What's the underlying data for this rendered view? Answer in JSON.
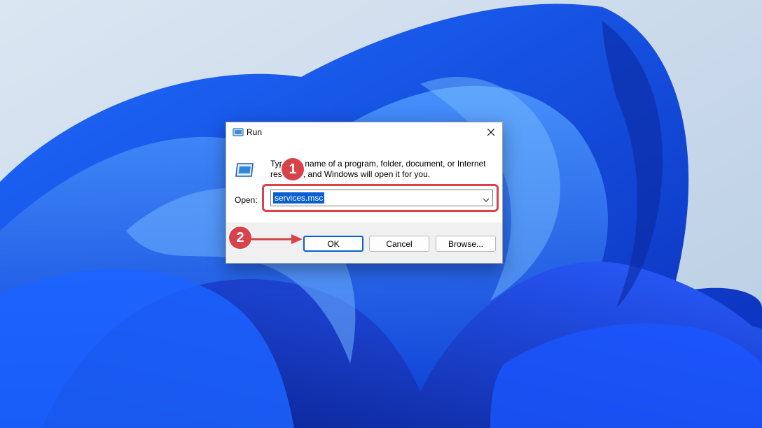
{
  "dialog": {
    "title": "Run",
    "description": "Type the name of a program, folder, document, or Internet resource, and Windows will open it for you.",
    "open_label": "Open:",
    "open_value": "services.msc",
    "buttons": {
      "ok": "OK",
      "cancel": "Cancel",
      "browse": "Browse..."
    }
  },
  "annotations": {
    "step1": "1",
    "step2": "2",
    "color": "#d9424b"
  },
  "icons": {
    "title": "run-icon",
    "close": "close-icon",
    "dropdown": "chevron-down-icon",
    "main": "run-program-icon"
  },
  "colors": {
    "accent": "#0a5fd0",
    "dialog_bg": "#f0f0f0",
    "annotation": "#d9424b"
  }
}
